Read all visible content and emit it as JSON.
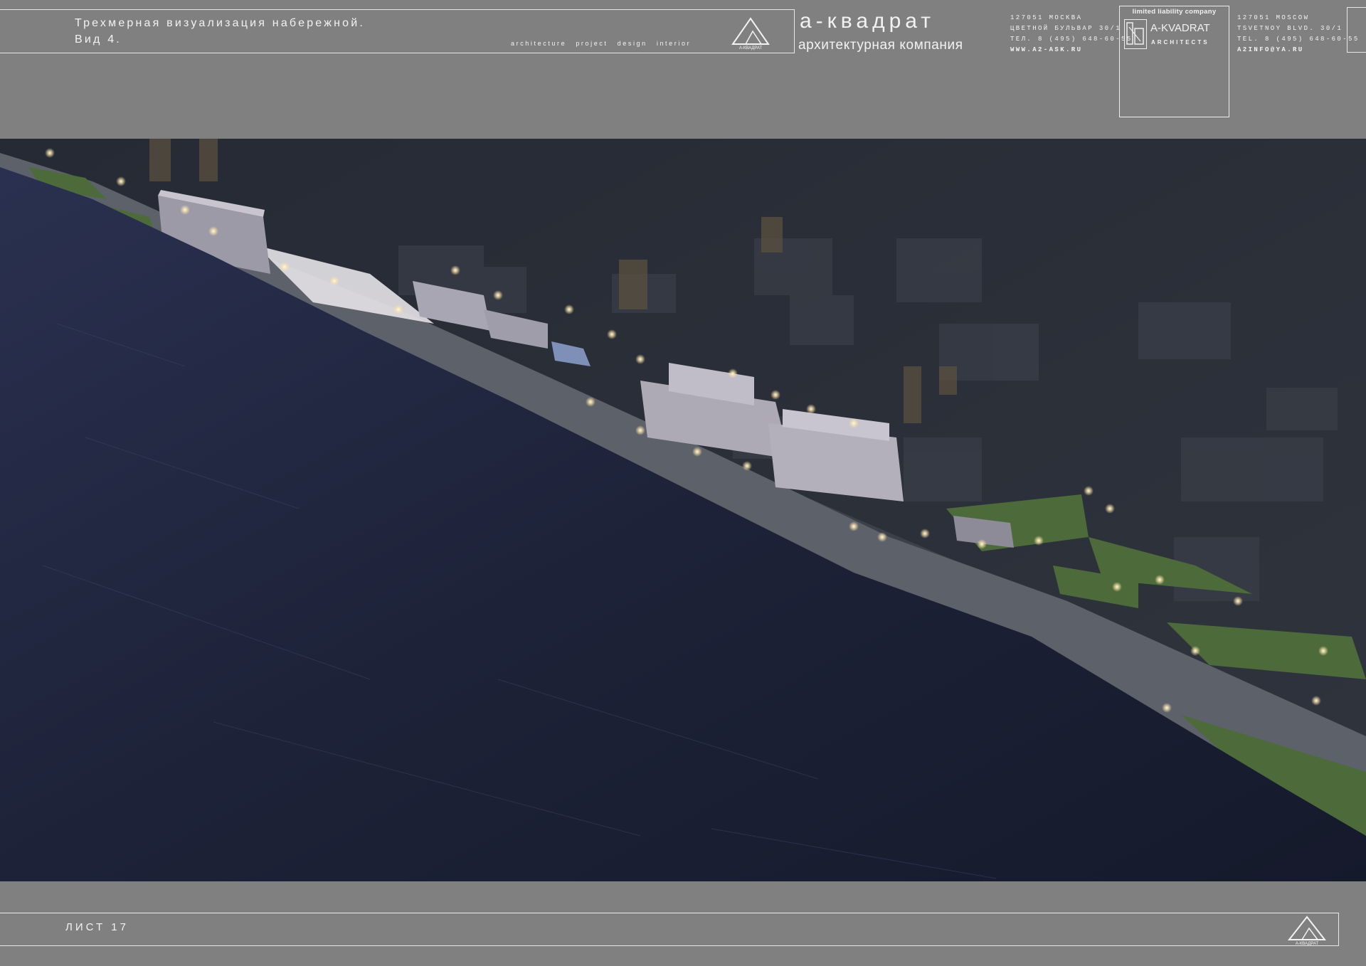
{
  "header": {
    "title_line1": "Трехмерная визуализация набережной.",
    "title_line2": "Вид 4.",
    "tagline": "architecture project design interior",
    "logo_caption": "А-КВАДРАТ",
    "brand_name": "а-квадрат",
    "brand_subtitle": "архитектурная компания"
  },
  "address_ru": {
    "line1": "127051 МОСКВА",
    "line2": "ЦВЕТНОЙ БУЛЬВАР 30/1",
    "line3": "ТЕЛ. 8 (495) 648-60-55",
    "line4": "WWW.A2-ASK.RU"
  },
  "badge": {
    "top": "limited liability company",
    "name": "A-KVADRAT",
    "sub": "ARCHITECTS"
  },
  "address_en": {
    "line1": "127051 MOSCOW",
    "line2": "TSVETNOY BLVD. 30/1",
    "line3": "TEL. 8 (495) 648-60-55",
    "line4": "A2INFO@YA.RU"
  },
  "footer": {
    "sheet_label": "ЛИСТ 17",
    "logo_caption": "А-КВАДРАТ"
  },
  "colors": {
    "background": "#808080",
    "water": "#1c2033",
    "city": "#2b2f38",
    "lawn": "#4d6b3a",
    "lamp": "#fff6d8"
  }
}
